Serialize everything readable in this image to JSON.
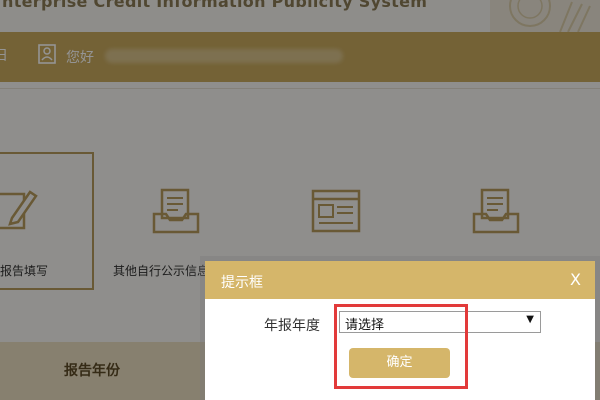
{
  "header": {
    "subtitle_fragment": "nterprise Credit Information Publicity System"
  },
  "nav": {
    "left_fragment": "日",
    "greeting": "您好",
    "user_icon": "user-card-icon"
  },
  "tiles": [
    {
      "label": "报告填写",
      "icon": "pencil-edit-icon"
    },
    {
      "label": "其他自行公示信息",
      "icon": "inbox-document-icon"
    },
    {
      "label": "",
      "icon": "browser-window-icon"
    },
    {
      "label": "",
      "icon": "inbox-document-icon"
    }
  ],
  "report_row": {
    "label": "报告年份"
  },
  "dialog": {
    "title": "提示框",
    "close_label": "X",
    "field_label": "年报年度",
    "select_value": "请选择",
    "confirm_label": "确定"
  },
  "colors": {
    "brand_gold": "#c8a95d",
    "dialog_gold": "#d5b66a",
    "highlight_red": "#e23a3a"
  }
}
